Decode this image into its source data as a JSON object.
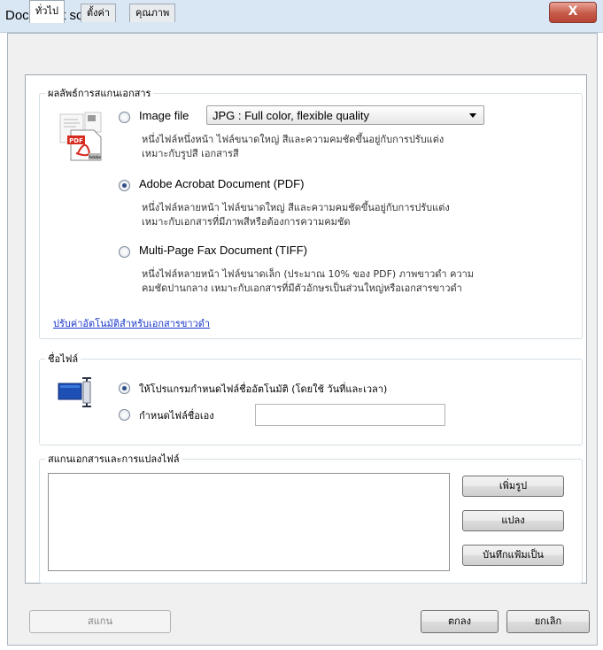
{
  "window": {
    "title": "Document scan",
    "close_glyph": "X"
  },
  "tabs": [
    {
      "label": "ทั่วไป",
      "active": true
    },
    {
      "label": "ตั้งค่า",
      "active": false
    },
    {
      "label": "คุณภาพ",
      "active": false
    }
  ],
  "output_group": {
    "legend": "ผลลัพธ์การสแกนเอกสาร",
    "options": [
      {
        "label": "Image file",
        "checked": false,
        "desc": [
          "หนึ่งไฟล์หนึ่งหน้า ไฟล์ขนาดใหญ่ สีและความคมชัดขึ้นอยู่กับการปรับแต่ง",
          "เหมาะกับรูปสี เอกสารสี"
        ]
      },
      {
        "label": "Adobe Acrobat Document (PDF)",
        "checked": true,
        "desc": [
          "หนึ่งไฟล์หลายหน้า ไฟล์ขนาดใหญ่ สีและความคมชัดขึ้นอยู่กับการปรับแต่ง",
          "เหมาะกับเอกสารที่มีภาพสีหรือต้องการความคมชัด"
        ]
      },
      {
        "label": "Multi-Page Fax Document (TIFF)",
        "checked": false,
        "desc": [
          "หนึ่งไฟล์หลายหน้า ไฟล์ขนาดเล็ก (ประมาณ 10% ของ PDF) ภาพขาวดำ ความ",
          "คมชัดปานกลาง เหมาะกับเอกสารที่มีตัวอักษรเป็นส่วนใหญ่หรือเอกสารขาวดำ"
        ]
      }
    ],
    "image_format": {
      "selected": "JPG : Full color, flexible quality"
    },
    "auto_link": "ปรับค่าอัตโนมัติสำหรับเอกสารขาวดำ",
    "pdf_icon_text": "PDF",
    "adobe_text": "Adobe"
  },
  "filename_group": {
    "legend": "ชื่อไฟล์",
    "auto_option": {
      "label": "ให้โปรแกรมกำหนดไฟล์ชื่ออัตโนมัติ (โดยใช้ วันที่และเวลา)",
      "checked": true
    },
    "manual_option": {
      "label": "กำหนดไฟล์ชื่อเอง",
      "checked": false
    },
    "manual_value": ""
  },
  "convert_group": {
    "legend": "สแกนเอกสารและการแปลงไฟล์",
    "buttons": {
      "add": "เพิ่มรูป",
      "convert": "แปลง",
      "save_as": "บันทึกแฟ้มเป็น"
    }
  },
  "footer": {
    "scan": "สแกน",
    "ok": "ตกลง",
    "cancel": "ยกเลิก"
  },
  "icons": {
    "pdf": "pdf-document-icon",
    "filename": "rename-file-icon",
    "close": "close-icon"
  }
}
